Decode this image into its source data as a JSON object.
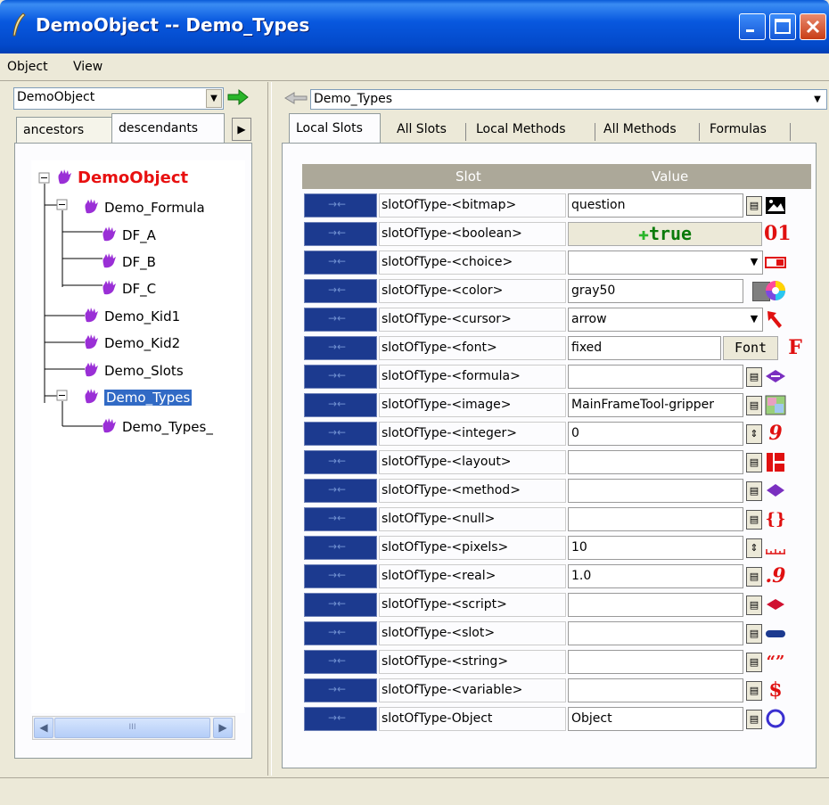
{
  "window": {
    "title": "DemoObject -- Demo_Types"
  },
  "menu": {
    "items": [
      "Object",
      "View"
    ]
  },
  "left": {
    "combo_value": "DemoObject",
    "tabs": [
      "ancestors",
      "descendants"
    ],
    "tree": [
      {
        "label": "DemoObject"
      },
      {
        "label": "Demo_Formula"
      },
      {
        "label": "DF_A"
      },
      {
        "label": "DF_B"
      },
      {
        "label": "DF_C"
      },
      {
        "label": "Demo_Kid1"
      },
      {
        "label": "Demo_Kid2"
      },
      {
        "label": "Demo_Slots"
      },
      {
        "label": "Demo_Types"
      },
      {
        "label": "Demo_Types_"
      }
    ],
    "scroll_grip": "III"
  },
  "right": {
    "combo_value": "Demo_Types",
    "tabs": [
      "Local Slots",
      "All Slots",
      "Local Methods",
      "All Methods",
      "Formulas"
    ],
    "grid": {
      "headers": [
        "Slot",
        "Value"
      ],
      "rows": [
        {
          "name": "slotOfType-<bitmap>",
          "value": "question",
          "icon": "bitmap-icon"
        },
        {
          "name": "slotOfType-<boolean>",
          "value": "true",
          "icon": "boolean-icon"
        },
        {
          "name": "slotOfType-<choice>",
          "value": "",
          "icon": "choice-icon"
        },
        {
          "name": "slotOfType-<color>",
          "value": "gray50",
          "icon": "color-icon"
        },
        {
          "name": "slotOfType-<cursor>",
          "value": "arrow",
          "icon": "cursor-icon"
        },
        {
          "name": "slotOfType-<font>",
          "value": "fixed",
          "icon": "font-icon"
        },
        {
          "name": "slotOfType-<formula>",
          "value": "",
          "icon": "formula-icon"
        },
        {
          "name": "slotOfType-<image>",
          "value": "MainFrameTool-gripper",
          "icon": "image-icon"
        },
        {
          "name": "slotOfType-<integer>",
          "value": "0",
          "icon": "integer-icon"
        },
        {
          "name": "slotOfType-<layout>",
          "value": "",
          "icon": "layout-icon"
        },
        {
          "name": "slotOfType-<method>",
          "value": "",
          "icon": "method-icon"
        },
        {
          "name": "slotOfType-<null>",
          "value": "",
          "icon": "null-icon"
        },
        {
          "name": "slotOfType-<pixels>",
          "value": "10",
          "icon": "pixels-icon"
        },
        {
          "name": "slotOfType-<real>",
          "value": "1.0",
          "icon": "real-icon"
        },
        {
          "name": "slotOfType-<script>",
          "value": "",
          "icon": "script-icon"
        },
        {
          "name": "slotOfType-<slot>",
          "value": "",
          "icon": "slot-icon"
        },
        {
          "name": "slotOfType-<string>",
          "value": "",
          "icon": "string-icon"
        },
        {
          "name": "slotOfType-<variable>",
          "value": "",
          "icon": "variable-icon"
        },
        {
          "name": "slotOfType-Object",
          "value": "Object",
          "icon": "object-icon"
        }
      ]
    },
    "font_button": "Font"
  },
  "colors": {
    "titlebar": "#0858df",
    "drag_handle": "#1c3a8f",
    "tree_root": "#e81010",
    "selection": "#316ac5",
    "true_text": "#0a7a0a"
  }
}
